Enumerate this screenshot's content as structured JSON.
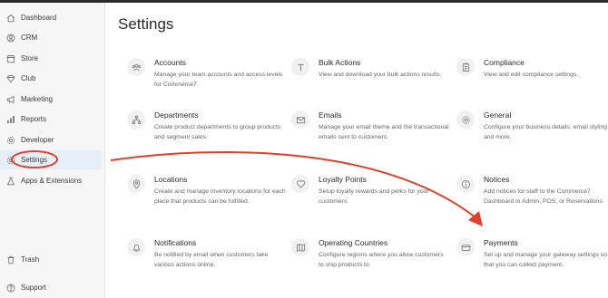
{
  "sidebar": {
    "items": [
      {
        "label": "Dashboard",
        "icon": "home-icon"
      },
      {
        "label": "CRM",
        "icon": "crm-icon"
      },
      {
        "label": "Store",
        "icon": "store-icon"
      },
      {
        "label": "Club",
        "icon": "club-icon"
      },
      {
        "label": "Marketing",
        "icon": "megaphone-icon"
      },
      {
        "label": "Reports",
        "icon": "chart-icon"
      },
      {
        "label": "Developer",
        "icon": "gear-icon"
      },
      {
        "label": "Settings",
        "icon": "settings-icon"
      },
      {
        "label": "Apps & Extensions",
        "icon": "flask-icon"
      }
    ],
    "trash": {
      "label": "Trash",
      "icon": "trash-icon"
    },
    "support": {
      "label": "Support",
      "icon": "help-icon"
    }
  },
  "main": {
    "title": "Settings",
    "cards": [
      {
        "title": "Accounts",
        "desc": "Manage your team accounts and access levels for Commerce7.",
        "icon": "users-icon"
      },
      {
        "title": "Bulk Actions",
        "desc": "View and download your bulk actions results.",
        "icon": "text-icon"
      },
      {
        "title": "Compliance",
        "desc": "View and edit compliance settings.",
        "icon": "clipboard-icon"
      },
      {
        "title": "Departments",
        "desc": "Create product departments to group products and segment sales.",
        "icon": "hierarchy-icon"
      },
      {
        "title": "Emails",
        "desc": "Manage your email theme and the transactional emails sent to customers.",
        "icon": "envelope-icon"
      },
      {
        "title": "General",
        "desc": "Configure your business details, email styling and more.",
        "icon": "cog-icon"
      },
      {
        "title": "Locations",
        "desc": "Create and manage inventory locations for each place that products can be fulfilled.",
        "icon": "pin-icon"
      },
      {
        "title": "Loyalty Points",
        "desc": "Setup loyalty rewards and perks for your customers.",
        "icon": "heart-icon"
      },
      {
        "title": "Notices",
        "desc": "Add notices for staff to the Commerce7 Dashboard in Admin, POS, or Reservations.",
        "icon": "info-icon"
      },
      {
        "title": "Notifications",
        "desc": "Be notified by email when customers take various actions online.",
        "icon": "bell-icon"
      },
      {
        "title": "Operating Countries",
        "desc": "Configure regions where you allow customers to ship products to.",
        "icon": "map-icon"
      },
      {
        "title": "Payments",
        "desc": "Set up and manage your gateway settings so that you can collect payment.",
        "icon": "credit-card-icon"
      }
    ]
  },
  "colors": {
    "annotation": "#e0412a",
    "active_bg": "#e6eef8"
  }
}
